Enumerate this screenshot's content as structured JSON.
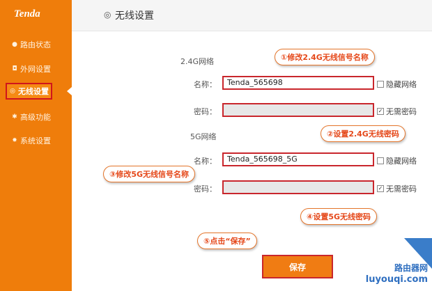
{
  "sidebar": {
    "logo": "Tenda",
    "items": [
      {
        "label": "路由状态",
        "icon": "circle-dot-icon"
      },
      {
        "label": "外网设置",
        "icon": "globe-icon"
      },
      {
        "label": "无线设置",
        "icon": "wifi-icon",
        "active": true
      },
      {
        "label": "高级功能",
        "icon": "tools-icon"
      },
      {
        "label": "系统设置",
        "icon": "gear-icon"
      }
    ]
  },
  "header": {
    "title": "无线设置",
    "icon": "wifi-icon"
  },
  "band24": {
    "section_label": "2.4G网络",
    "name_label": "名称：",
    "name_value": "Tenda_565698",
    "hide_label": "隐藏网络",
    "password_label": "密码：",
    "password_value": "",
    "no_password_label": "无需密码",
    "no_password_checked": true
  },
  "band5": {
    "section_label": "5G网络",
    "name_label": "名称：",
    "name_value": "Tenda_565698_5G",
    "hide_label": "隐藏网络",
    "password_label": "密码：",
    "password_value": "",
    "no_password_label": "无需密码",
    "no_password_checked": true
  },
  "annotations": {
    "a1": "①修改2.4G无线信号名称",
    "a2": "②设置2.4G无线密码",
    "a3": "③修改5G无线信号名称",
    "a4": "④设置5G无线密码",
    "a5": "⑤点击“保存”"
  },
  "save_label": "保存",
  "watermark": {
    "line1": "路由器网",
    "line2": "luyouqi.com"
  },
  "colors": {
    "sidebar": "#ef7d0b",
    "highlight": "#c9262c",
    "annotation_text": "#e5481a",
    "save_button": "#f07c13"
  }
}
